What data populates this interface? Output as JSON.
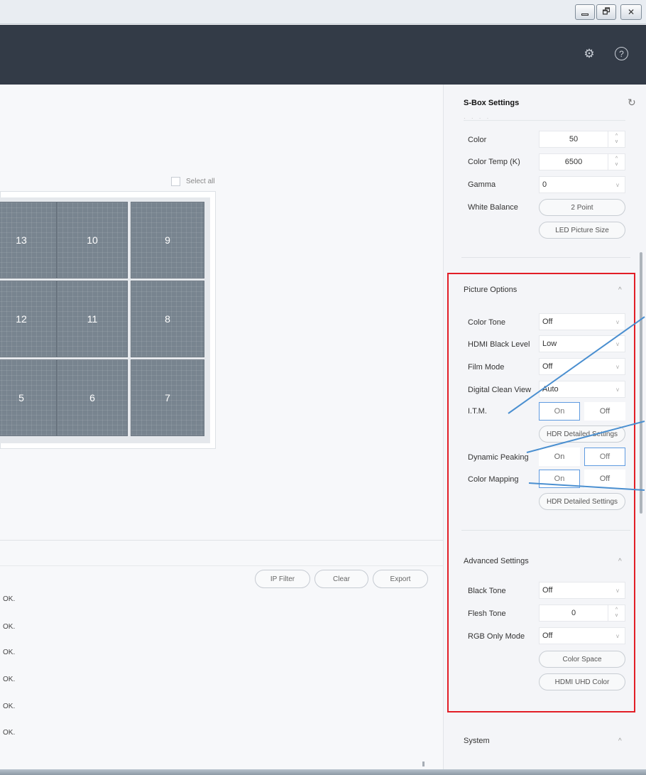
{
  "window": {
    "minimize_glyph": "",
    "maximize_glyph": "🗗",
    "close_glyph": "✕"
  },
  "header": {
    "gear_icon": "⚙",
    "help_icon": "?"
  },
  "screen_grid": {
    "select_all_label": "Select all",
    "tiles": [
      "13",
      "10",
      "9",
      "12",
      "11",
      "8",
      "5",
      "6",
      "7"
    ]
  },
  "log": {
    "buttons": {
      "ip_filter": "IP Filter",
      "clear": "Clear",
      "export": "Export"
    },
    "lines": [
      "OK.",
      "OK.",
      "OK.",
      "OK.",
      "OK.",
      "OK."
    ]
  },
  "sbox": {
    "title": "S-Box Settings",
    "refresh_icon": "↻",
    "faint_row": "· · · ·",
    "color": {
      "label": "Color",
      "value": "50"
    },
    "color_temp": {
      "label": "Color Temp (K)",
      "value": "6500"
    },
    "gamma": {
      "label": "Gamma",
      "value": "0"
    },
    "white_balance": {
      "label": "White Balance",
      "button": "2 Point"
    },
    "led_picture_size": "LED Picture Size",
    "picture_options": {
      "title": "Picture Options",
      "color_tone": {
        "label": "Color Tone",
        "value": "Off"
      },
      "hdmi_black_level": {
        "label": "HDMI Black Level",
        "value": "Low"
      },
      "film_mode": {
        "label": "Film Mode",
        "value": "Off"
      },
      "digital_clean_view": {
        "label": "Digital Clean View",
        "value": "Auto"
      },
      "itm": {
        "label": "I.T.M.",
        "on": "On",
        "off": "Off"
      },
      "hdr_detailed_1": "HDR Detailed Settings",
      "dynamic_peaking": {
        "label": "Dynamic Peaking",
        "on": "On",
        "off": "Off"
      },
      "color_mapping": {
        "label": "Color Mapping",
        "on": "On",
        "off": "Off"
      },
      "hdr_detailed_2": "HDR Detailed Settings"
    },
    "advanced_settings": {
      "title": "Advanced Settings",
      "black_tone": {
        "label": "Black Tone",
        "value": "Off"
      },
      "flesh_tone": {
        "label": "Flesh Tone",
        "value": "0"
      },
      "rgb_only_mode": {
        "label": "RGB Only Mode",
        "value": "Off"
      },
      "color_space": "Color Space",
      "hdmi_uhd_color": "HDMI UHD Color"
    },
    "system": {
      "title": "System"
    },
    "caret_up": "^",
    "chevron_down": "v",
    "spin_up": "^",
    "spin_down": "v"
  },
  "colors": {
    "header_bg": "#333b47",
    "highlight_red": "#e21e26",
    "annotation_blue": "#4a8fd0",
    "toggle_active": "#5f9be0",
    "tile_gray": "#78848f"
  }
}
